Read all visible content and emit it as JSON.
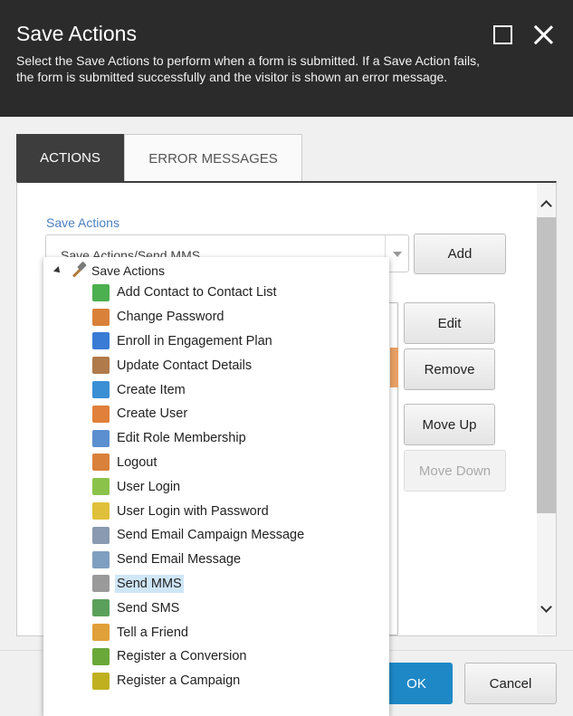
{
  "dialog": {
    "title": "Save Actions",
    "description": "Select the Save Actions to perform when a form is submitted. If a Save Action fails, the form is submitted successfully and the visitor is shown an error message."
  },
  "tabs": [
    {
      "label": "ACTIONS",
      "active": true
    },
    {
      "label": "ERROR MESSAGES",
      "active": false
    }
  ],
  "save_actions": {
    "label": "Save Actions",
    "selected_value": "Save Actions/Send MMS"
  },
  "buttons": {
    "add": "Add",
    "edit": "Edit",
    "remove": "Remove",
    "move_up": "Move Up",
    "move_down": "Move Down",
    "ok": "OK",
    "cancel": "Cancel"
  },
  "dropdown": {
    "root_label": "Save Actions",
    "items": [
      {
        "label": "Add Contact to Contact List",
        "icon": "contact-list-icon",
        "color": "#4caf50"
      },
      {
        "label": "Change Password",
        "icon": "user-key-icon",
        "color": "#d9813a"
      },
      {
        "label": "Enroll in Engagement Plan",
        "icon": "engagement-plan-icon",
        "color": "#3a7bd5"
      },
      {
        "label": "Update Contact Details",
        "icon": "contact-details-icon",
        "color": "#b07a4a"
      },
      {
        "label": "Create Item",
        "icon": "create-item-icon",
        "color": "#3a8fd5"
      },
      {
        "label": "Create User",
        "icon": "create-user-icon",
        "color": "#e0803a"
      },
      {
        "label": "Edit Role Membership",
        "icon": "role-membership-icon",
        "color": "#5b8fd0"
      },
      {
        "label": "Logout",
        "icon": "logout-icon",
        "color": "#d9813a"
      },
      {
        "label": "User Login",
        "icon": "user-login-icon",
        "color": "#8bc34a"
      },
      {
        "label": "User Login with Password",
        "icon": "user-login-password-icon",
        "color": "#e0c03a"
      },
      {
        "label": "Send Email Campaign Message",
        "icon": "email-campaign-icon",
        "color": "#8a9ab0"
      },
      {
        "label": "Send Email Message",
        "icon": "email-message-icon",
        "color": "#7f9fc0"
      },
      {
        "label": "Send MMS",
        "icon": "mms-icon",
        "color": "#9a9a9a",
        "selected": true
      },
      {
        "label": "Send SMS",
        "icon": "sms-icon",
        "color": "#5aa05a"
      },
      {
        "label": "Tell a Friend",
        "icon": "tell-friend-icon",
        "color": "#e0a03a"
      },
      {
        "label": "Register a Conversion",
        "icon": "flag-icon",
        "color": "#6aa83a"
      },
      {
        "label": "Register a Campaign",
        "icon": "campaign-icon",
        "color": "#c0b020"
      }
    ]
  }
}
